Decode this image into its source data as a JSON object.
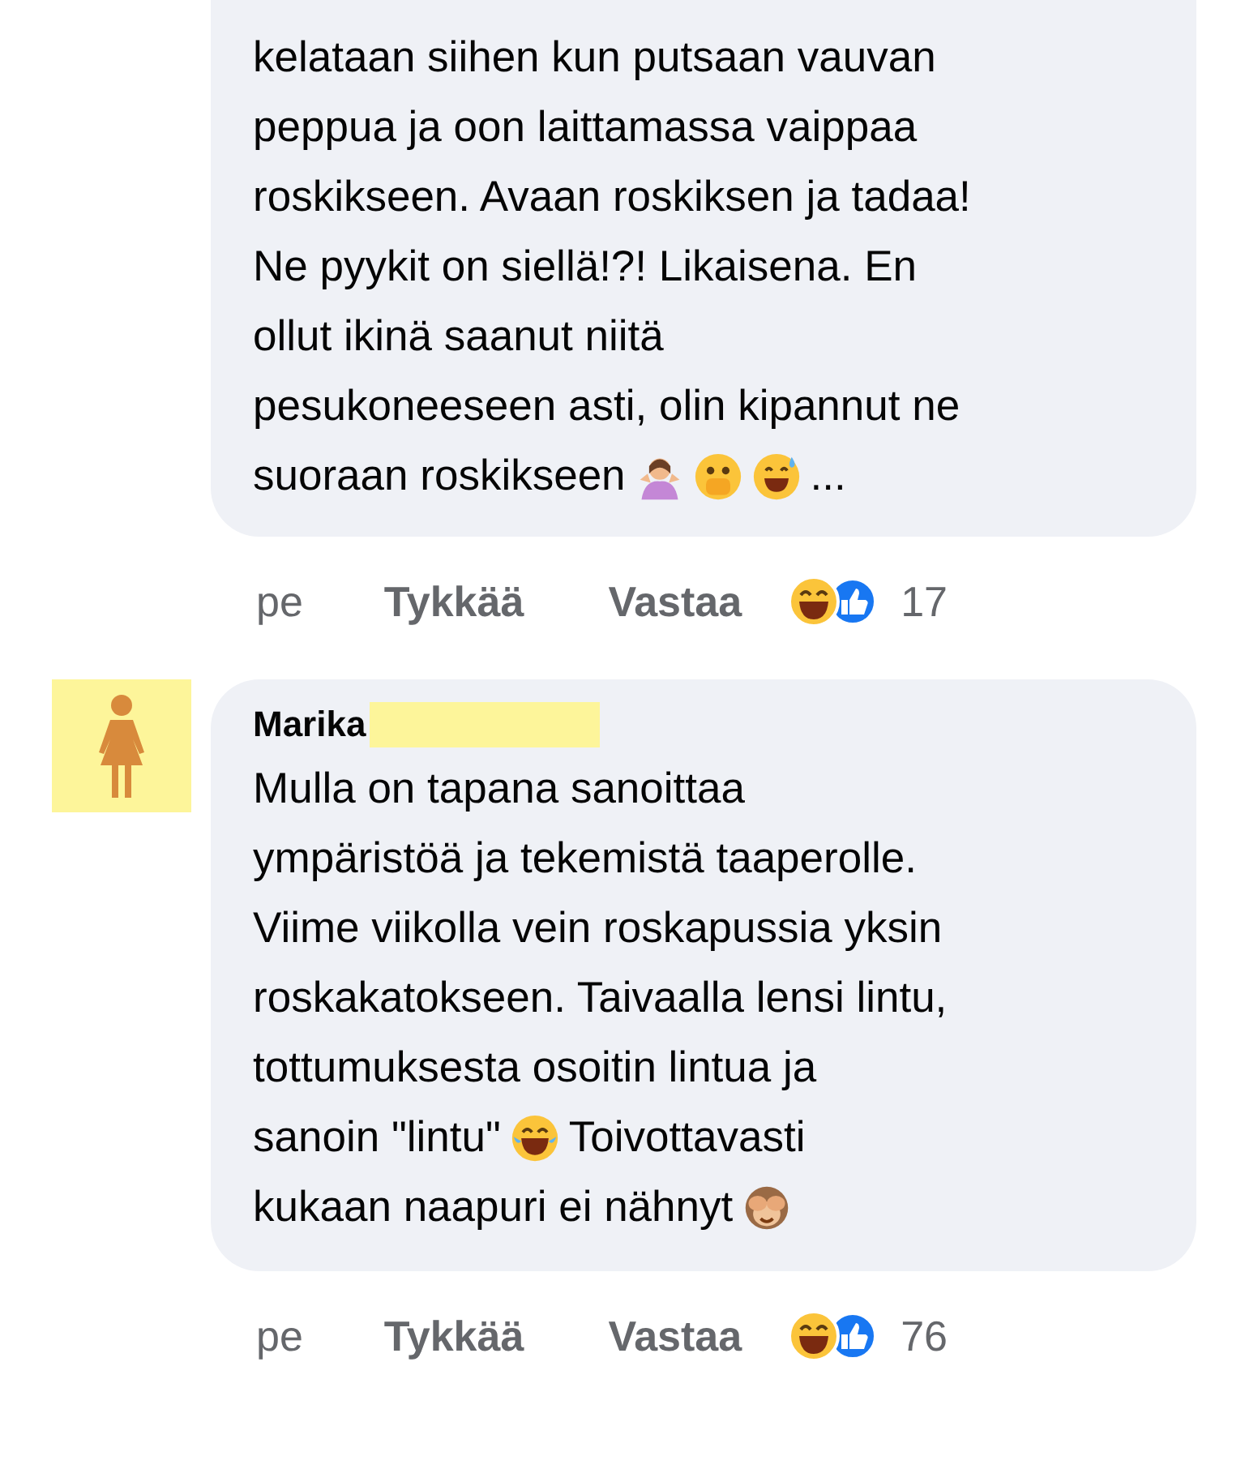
{
  "comments": [
    {
      "avatar": false,
      "redacted": false,
      "lines": [
        [
          {
            "kind": "text",
            "text": "kelataan siihen kun putsaan vauvan"
          }
        ],
        [
          {
            "kind": "text",
            "text": "peppua ja oon laittamassa vaippaa"
          }
        ],
        [
          {
            "kind": "text",
            "text": "roskikseen. Avaan roskiksen ja tadaa!"
          }
        ],
        [
          {
            "kind": "text",
            "text": "Ne pyykit on siellä!?! Likaisena. En"
          }
        ],
        [
          {
            "kind": "text",
            "text": "ollut ikinä saanut niitä"
          }
        ],
        [
          {
            "kind": "text",
            "text": "pesukoneeseen asti, olin kipannut ne"
          }
        ],
        [
          {
            "kind": "text",
            "text": "suoraan roskikseen"
          },
          {
            "kind": "shrug"
          },
          {
            "kind": "peek"
          },
          {
            "kind": "sweat"
          },
          {
            "kind": "text",
            "text": "..."
          }
        ]
      ],
      "time": "pe",
      "like": "Tykkää",
      "reply": "Vastaa",
      "count": "17"
    },
    {
      "avatar": true,
      "author": "Marika",
      "redacted": true,
      "lines": [
        [
          {
            "kind": "text",
            "text": "Mulla on tapana sanoittaa"
          }
        ],
        [
          {
            "kind": "text",
            "text": "ympäristöä ja tekemistä taaperolle."
          }
        ],
        [
          {
            "kind": "text",
            "text": "Viime viikolla vein roskapussia yksin"
          }
        ],
        [
          {
            "kind": "text",
            "text": "roskakatokseen. Taivaalla lensi lintu,"
          }
        ],
        [
          {
            "kind": "text",
            "text": "tottumuksesta osoitin lintua ja"
          }
        ],
        [
          {
            "kind": "text",
            "text": "sanoin \"lintu\""
          },
          {
            "kind": "tears"
          },
          {
            "kind": "text",
            "text": "Toivottavasti"
          }
        ],
        [
          {
            "kind": "text",
            "text": "kukaan naapuri ei nähnyt"
          },
          {
            "kind": "monkey"
          }
        ]
      ],
      "time": "pe",
      "like": "Tykkää",
      "reply": "Vastaa",
      "count": "76"
    }
  ]
}
